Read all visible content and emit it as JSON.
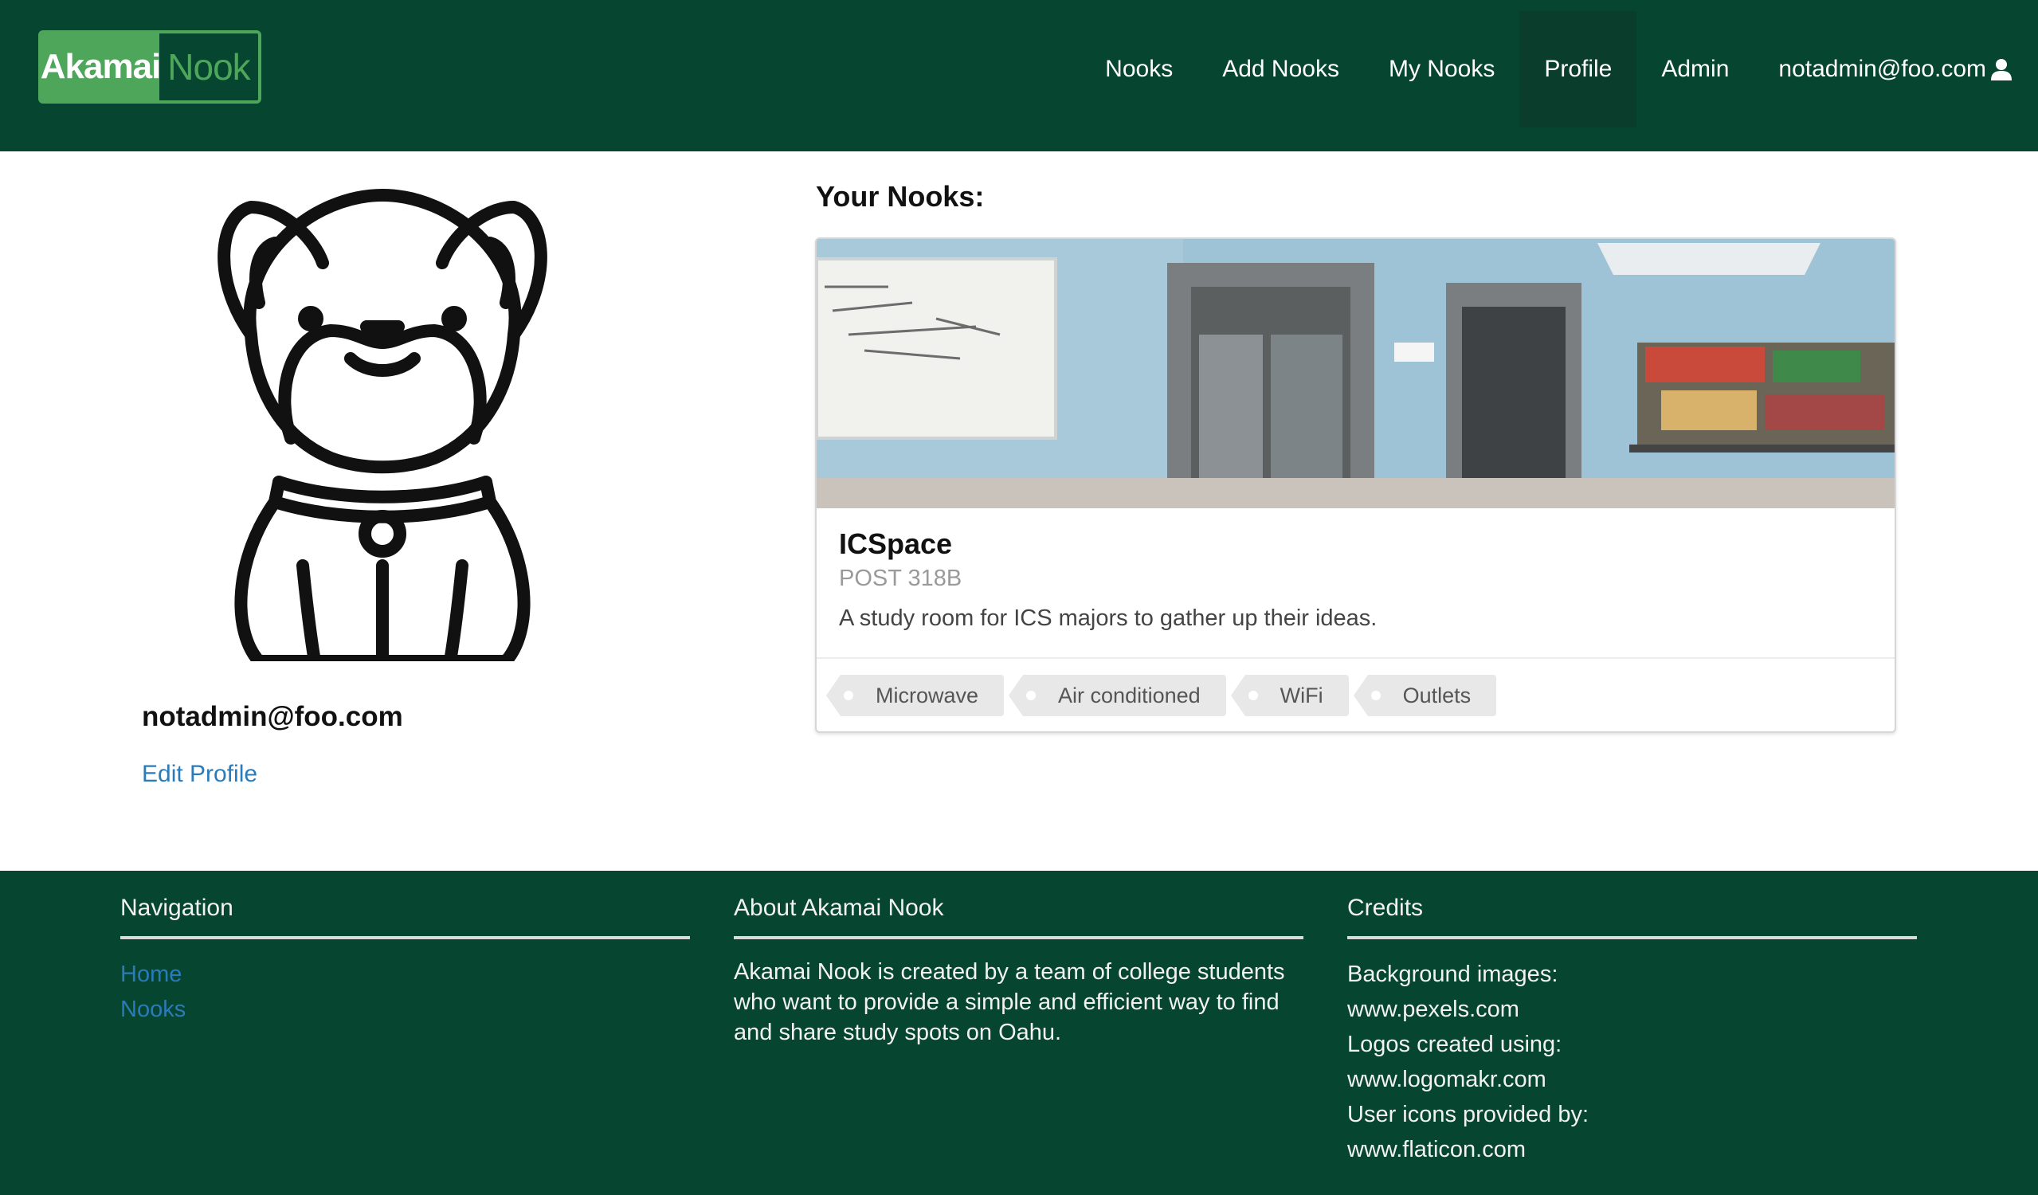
{
  "colors": {
    "brand_dark_green": "#064530",
    "brand_light_green": "#4ea65b",
    "link_blue": "#2b7bb9"
  },
  "navbar": {
    "logo_word1": "Akamai",
    "logo_word2": "Nook",
    "links": [
      {
        "label": "Nooks"
      },
      {
        "label": "Add Nooks"
      },
      {
        "label": "My Nooks"
      },
      {
        "label": "Profile",
        "active": true
      },
      {
        "label": "Admin"
      },
      {
        "label": "notadmin@foo.com",
        "icon": "user-icon"
      }
    ]
  },
  "profile": {
    "avatar_icon": "bulldog-avatar-icon",
    "email": "notadmin@foo.com",
    "edit_label": "Edit Profile"
  },
  "nooks": {
    "heading": "Your Nooks:",
    "cards": [
      {
        "title": "ICSpace",
        "location": "POST 318B",
        "description": "A study room for ICS majors to gather up their ideas.",
        "tags": [
          "Microwave",
          "Air conditioned",
          "WiFi",
          "Outlets"
        ]
      }
    ]
  },
  "footer": {
    "navigation": {
      "heading": "Navigation",
      "links": [
        "Home",
        "Nooks"
      ]
    },
    "about": {
      "heading": "About Akamai Nook",
      "text": "Akamai Nook is created by a team of college students who want to provide a simple and efficient way to find and share study spots on Oahu."
    },
    "credits": {
      "heading": "Credits",
      "lines": [
        "Background images:",
        "www.pexels.com",
        "Logos created using:",
        "www.logomakr.com",
        "User icons provided by:",
        "www.flaticon.com"
      ]
    }
  }
}
